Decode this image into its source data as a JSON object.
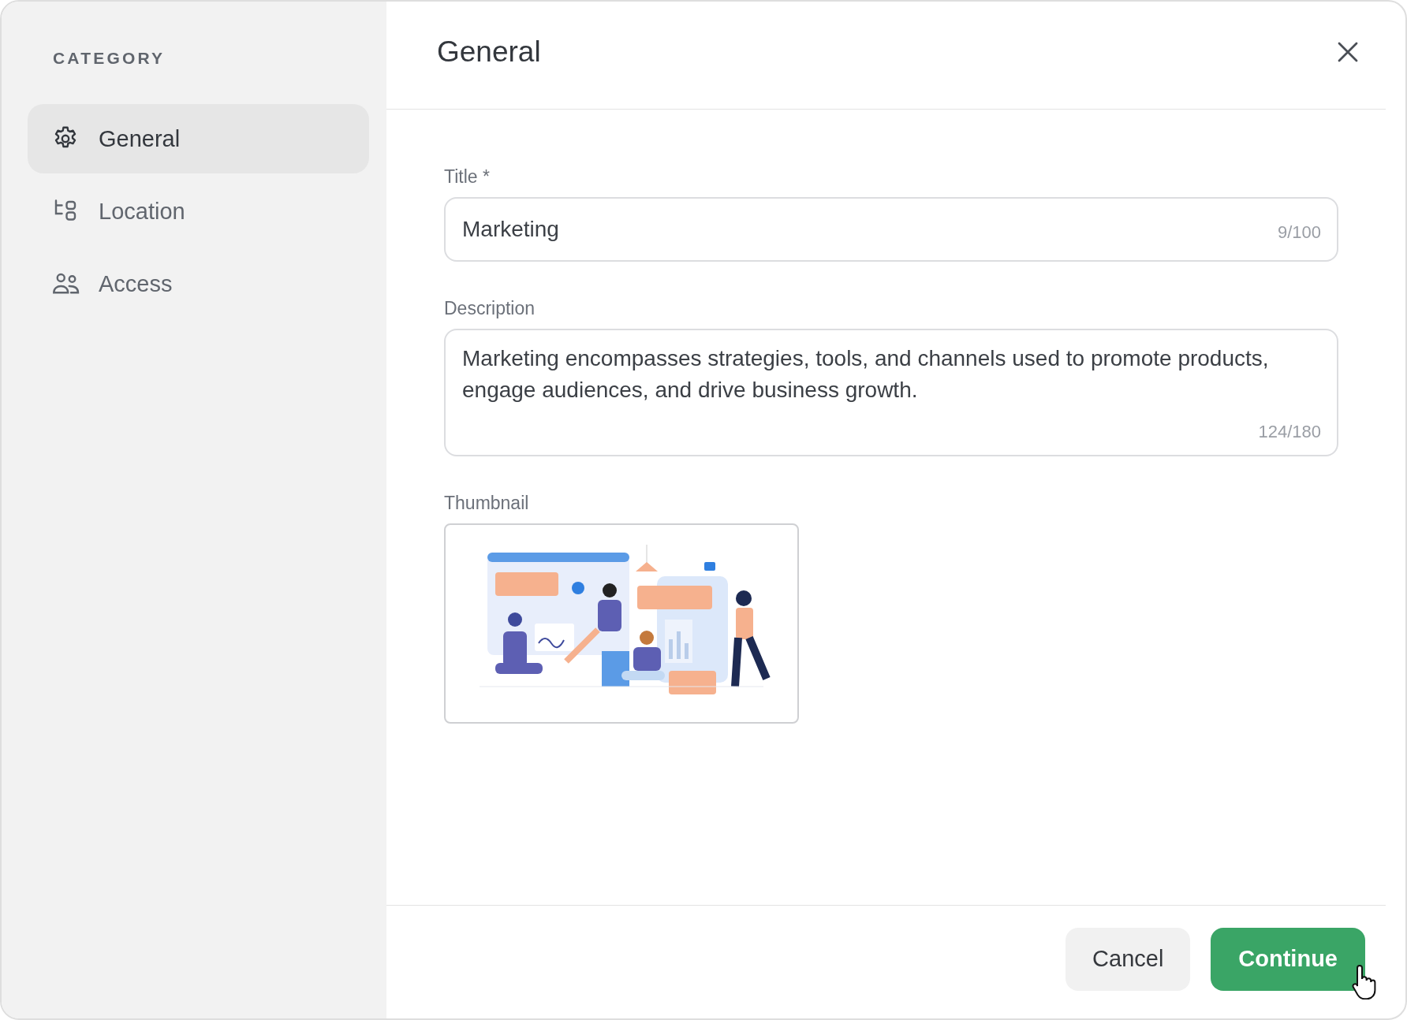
{
  "sidebar": {
    "heading": "CATEGORY",
    "items": [
      {
        "label": "General",
        "selected": true
      },
      {
        "label": "Location",
        "selected": false
      },
      {
        "label": "Access",
        "selected": false
      }
    ]
  },
  "panel": {
    "title": "General",
    "fields": [
      {
        "kind": "input",
        "label": "Title *",
        "value": "Marketing",
        "counter": "9/100"
      },
      {
        "kind": "textarea",
        "label": "Description",
        "value": "Marketing encompasses strategies, tools, and channels used to promote products, engage audiences, and drive business growth.",
        "counter": "124/180"
      },
      {
        "kind": "image",
        "label": "Thumbnail"
      }
    ],
    "buttons": [
      {
        "label": "Cancel",
        "kind": "secondary"
      },
      {
        "label": "Continue",
        "kind": "primary"
      }
    ]
  }
}
